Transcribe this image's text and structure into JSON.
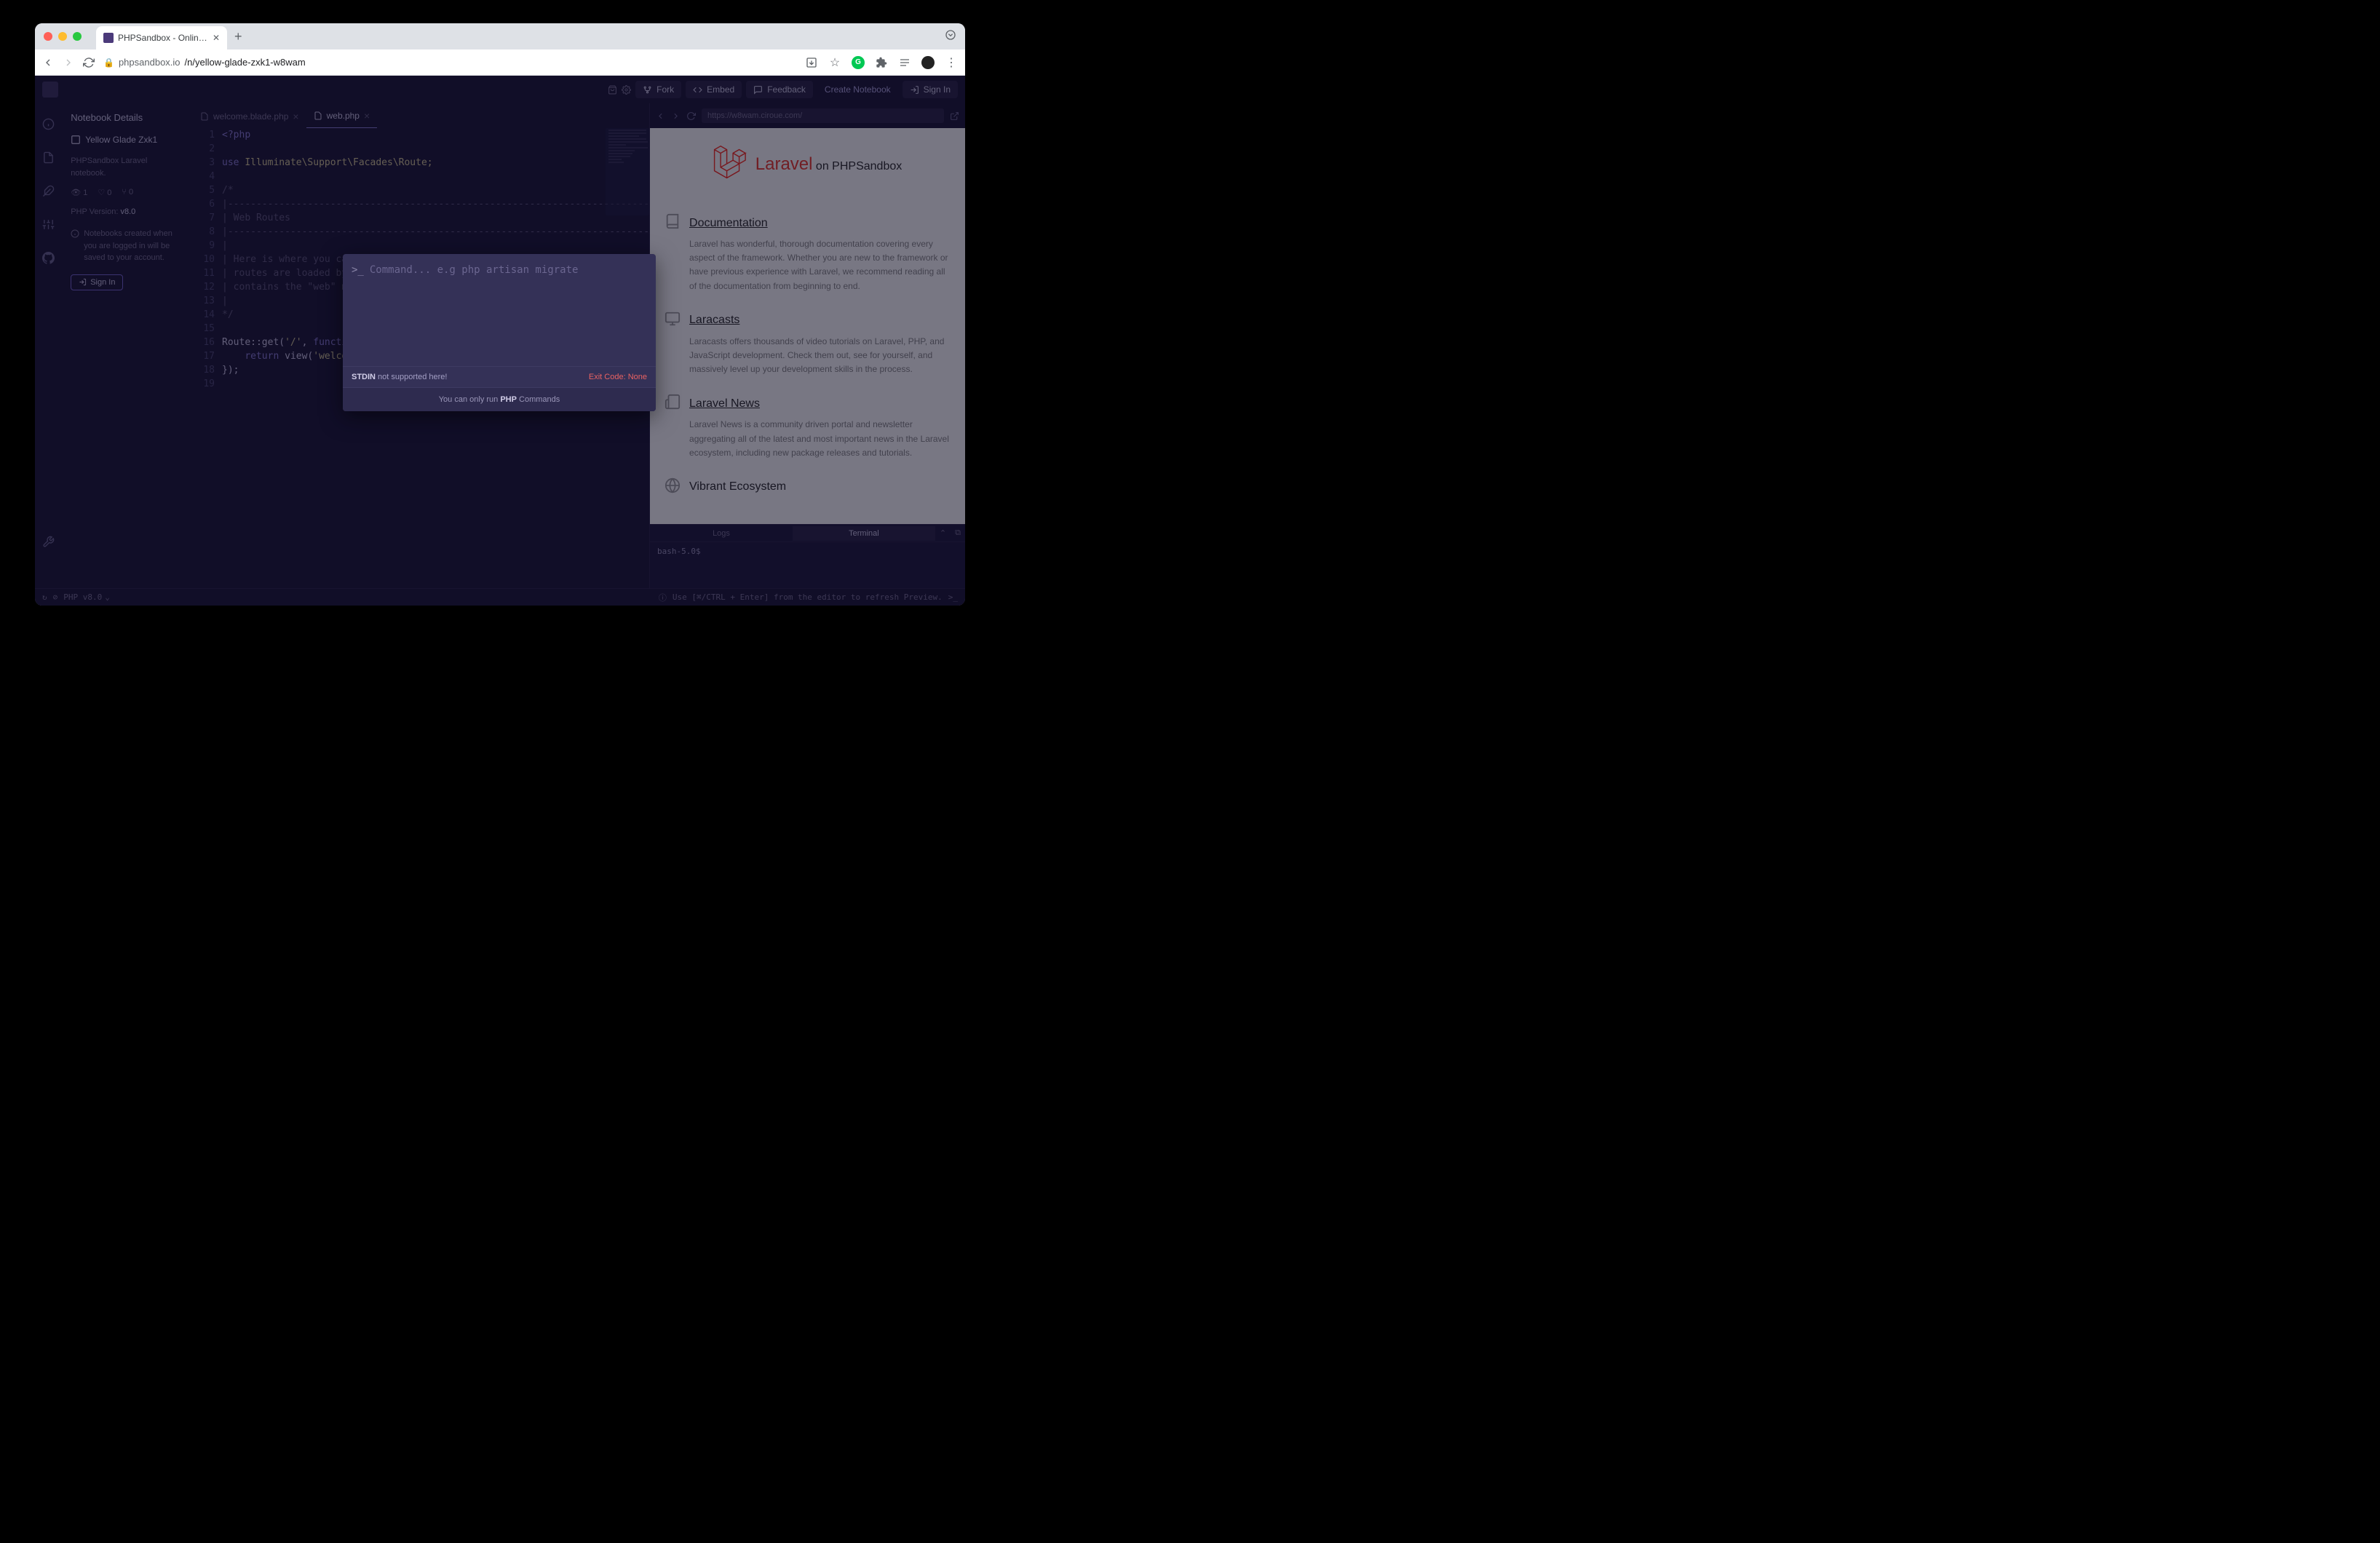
{
  "browser": {
    "tab_title": "PHPSandbox - Online Code Sa",
    "url_host": "phpsandbox.io",
    "url_path": "/n/yellow-glade-zxk1-w8wam"
  },
  "header": {
    "fork": "Fork",
    "embed": "Embed",
    "feedback": "Feedback",
    "create": "Create Notebook",
    "signin": "Sign In"
  },
  "details": {
    "title": "Notebook Details",
    "name": "Yellow Glade Zxk1",
    "desc": "PHPSandbox Laravel notebook.",
    "views": "1",
    "likes": "0",
    "forks": "0",
    "php_label": "PHP Version:",
    "php_ver": "v8.0",
    "info": "Notebooks created when you are logged in will be saved to your account.",
    "signin": "Sign In"
  },
  "editor": {
    "tabs": [
      {
        "label": "welcome.blade.php",
        "active": false
      },
      {
        "label": "web.php",
        "active": true
      }
    ],
    "lines": {
      "n1": "1",
      "n2": "2",
      "n3": "3",
      "n4": "4",
      "n5": "5",
      "n6": "6",
      "n7": "7",
      "n8": "8",
      "n9": "9",
      "n10": "10",
      "n11": "11",
      "n12": "12",
      "n13": "13",
      "n14": "14",
      "n15": "15",
      "n16": "16",
      "n17": "17",
      "n18": "18",
      "n19": "19"
    },
    "code": {
      "l1": "<?php",
      "l3_use": "use",
      "l3_ns": " Illuminate\\Support\\Facades\\Route;",
      "l5": "/*",
      "l6": "|--------------------------------------------------------------------------",
      "l7": "| Web Routes",
      "l8": "|--------------------------------------------------------------------------",
      "l9": "|",
      "l10": "| Here is where you can",
      "l11": "| routes are loaded by",
      "l12": "| contains the \"web\" m",
      "l13": "|",
      "l14": "*/",
      "l16a": "Route::get(",
      "l16b": "'/'",
      "l16c": ", ",
      "l16d": "functi",
      "l17a": "    ",
      "l17b": "return",
      "l17c": " view(",
      "l17d": "'welco",
      "l18": "});"
    }
  },
  "preview": {
    "url": "https://w8wam.ciroue.com/",
    "brand": "Laravel",
    "on": " on PHPSandbox",
    "cards": [
      {
        "title": "Documentation",
        "link": true,
        "body": "Laravel has wonderful, thorough documentation covering every aspect of the framework. Whether you are new to the framework or have previous experience with Laravel, we recommend reading all of the documentation from beginning to end."
      },
      {
        "title": "Laracasts",
        "link": true,
        "body": "Laracasts offers thousands of video tutorials on Laravel, PHP, and JavaScript development. Check them out, see for yourself, and massively level up your development skills in the process."
      },
      {
        "title": "Laravel News",
        "link": true,
        "body": "Laravel News is a community driven portal and newsletter aggregating all of the latest and most important news in the Laravel ecosystem, including new package releases and tutorials."
      },
      {
        "title": "Vibrant Ecosystem",
        "link": false,
        "body": ""
      }
    ]
  },
  "terminal": {
    "tabs": {
      "logs": "Logs",
      "terminal": "Terminal"
    },
    "prompt": "bash-5.0$"
  },
  "statusbar": {
    "php": "PHP v8.0",
    "hint": "Use [⌘/CTRL + Enter] from the editor to refresh Preview."
  },
  "modal": {
    "prompt": ">_",
    "placeholder": "Command... e.g php artisan migrate",
    "stdin_bold": "STDIN",
    "stdin_rest": " not supported here!",
    "exit": "Exit Code: None",
    "footer_pre": "You can only run ",
    "footer_bold": "PHP",
    "footer_post": " Commands"
  }
}
